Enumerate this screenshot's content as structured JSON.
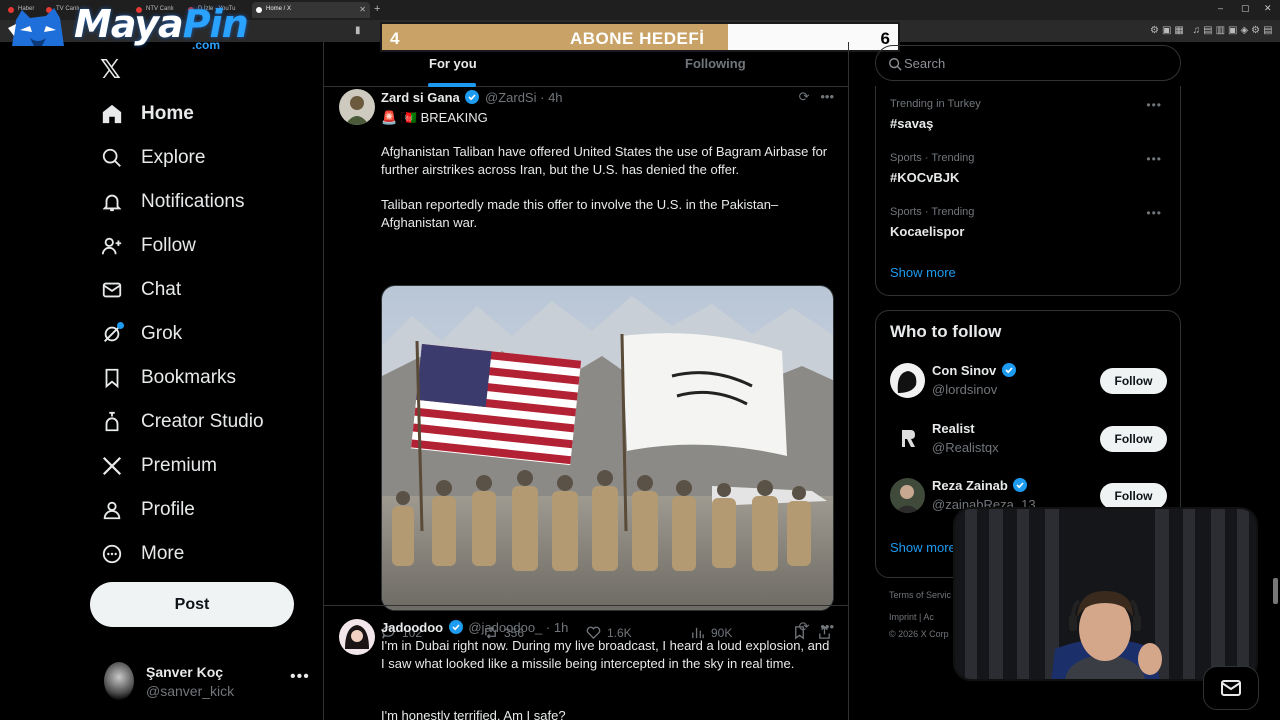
{
  "browser": {
    "tabs": [
      {
        "label": "Haber"
      },
      {
        "label": "TV Canlı"
      },
      {
        "label": "NTV Canlı"
      },
      {
        "label": "D İzle - YouTu"
      },
      {
        "label": "Home / X"
      }
    ],
    "window_controls": [
      "–",
      "▢",
      "✕"
    ]
  },
  "overlay": {
    "brand_main": "Maya",
    "brand_accent": "Pin",
    "brand_suffix": ".com",
    "goal": {
      "current": "4",
      "label": "ABONE HEDEFİ",
      "target": "6",
      "progress": 0.67
    }
  },
  "nav": {
    "items": [
      {
        "label": "Home",
        "icon": "home-icon",
        "active": true
      },
      {
        "label": "Explore",
        "icon": "search-icon"
      },
      {
        "label": "Notifications",
        "icon": "bell-icon"
      },
      {
        "label": "Follow",
        "icon": "person-add-icon"
      },
      {
        "label": "Chat",
        "icon": "mail-icon"
      },
      {
        "label": "Grok",
        "icon": "grok-icon"
      },
      {
        "label": "Bookmarks",
        "icon": "bookmark-icon"
      },
      {
        "label": "Creator Studio",
        "icon": "creator-studio-icon"
      },
      {
        "label": "Premium",
        "icon": "x-premium-icon"
      },
      {
        "label": "Profile",
        "icon": "person-icon"
      },
      {
        "label": "More",
        "icon": "more-circle-icon"
      }
    ],
    "post_label": "Post",
    "account": {
      "name": "Şanver Koç",
      "handle": "@sanver_kick"
    }
  },
  "timeline": {
    "tabs": [
      {
        "label": "For you"
      },
      {
        "label": "Following"
      }
    ],
    "tweets": [
      {
        "name": "Zard si Gana",
        "handle": "@ZardSi",
        "time": "· 4h",
        "tag": "🚨 🇦🇫 BREAKING",
        "para1": "Afghanistan Taliban have offered United States the use of Bagram Airbase for further airstrikes across Iran, but the U.S. has denied the offer.",
        "para2": "Taliban reportedly made this offer to involve the U.S. in the Pakistan–Afghanistan war.",
        "replies": "102",
        "reposts": "356",
        "likes": "1.6K",
        "views": "90K"
      },
      {
        "name": "Jadoodoo",
        "handle": "@jadoodoo_",
        "time": "· 1h",
        "para1": "I'm in Dubai right now. During my live broadcast, I heard a loud explosion, and I saw what looked like a missile being intercepted in the sky in real time.",
        "para2": "I'm honestly terrified. Am I safe?"
      }
    ]
  },
  "sidebar": {
    "search_placeholder": "Search",
    "trends": [
      {
        "context": "Trending in Turkey",
        "title": "#savaş"
      },
      {
        "context": "Sports · Trending",
        "title": "#KOCvBJK"
      },
      {
        "context": "Sports · Trending",
        "title": "Kocaelispor"
      }
    ],
    "trends_show_more": "Show more",
    "who_to_follow_title": "Who to follow",
    "who_to_follow": [
      {
        "name": "Con Sinov",
        "handle": "@lordsinov",
        "verified": true,
        "button": "Follow"
      },
      {
        "name": "Realist",
        "handle": "@Realistqx",
        "verified": false,
        "button": "Follow"
      },
      {
        "name": "Reza Zainab",
        "handle": "@zainabReza_13",
        "verified": true,
        "button": "Follow"
      }
    ],
    "who_show_more": "Show more",
    "footer": {
      "line1": "Terms of Servic",
      "line2": "Imprint   |   Ac",
      "line3": "© 2026 X Corp"
    }
  },
  "colors": {
    "accent": "#1d9bf0",
    "background": "#000000",
    "border": "#2f3336",
    "muted": "#71767b",
    "goal_fill": "#c8a266"
  }
}
